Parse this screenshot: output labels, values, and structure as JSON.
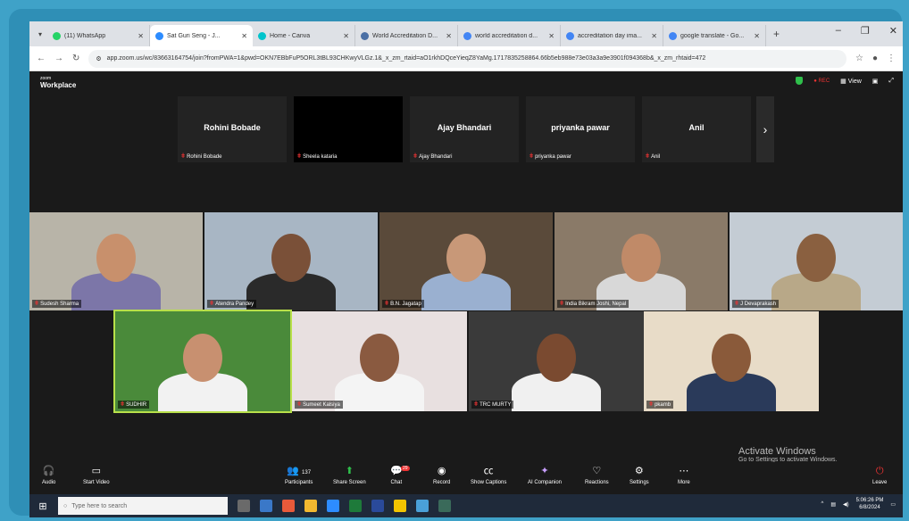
{
  "browser": {
    "tabs": [
      {
        "title": "(11) WhatsApp",
        "favicon_color": "#25d366",
        "active": false
      },
      {
        "title": "Sat Guri Seng - J...",
        "favicon_color": "#2d8cff",
        "active": true
      },
      {
        "title": "Home - Canva",
        "favicon_color": "#00c4cc",
        "active": false
      },
      {
        "title": "World Accreditation D...",
        "favicon_color": "#4a6fa5",
        "active": false
      },
      {
        "title": "world accreditation d...",
        "favicon_color": "#4285f4",
        "active": false
      },
      {
        "title": "accreditation day ima...",
        "favicon_color": "#4285f4",
        "active": false
      },
      {
        "title": "google translate - Go...",
        "favicon_color": "#4285f4",
        "active": false
      }
    ],
    "url": "app.zoom.us/wc/83663164754/join?fromPWA=1&pwd=OKN7EBbFuP5ORL3tBL93CHKwyVLGz.1&_x_zm_rtaid=aO1rkhDQceYieqZ8YaMg.1717835258864.66b5eb988e73e03a3a9e3901f094368b&_x_zm_rhtaid=472"
  },
  "zoom": {
    "logo_top": "zoom",
    "logo_bottom": "Workplace",
    "rec_label": "● REC",
    "view_label": "View"
  },
  "top_strip": [
    {
      "display": "Rohini Bobade",
      "label": "Rohini Bobade"
    },
    {
      "display": "",
      "label": "Sheela kataria"
    },
    {
      "display": "Ajay Bhandari",
      "label": "Ajay Bhandari"
    },
    {
      "display": "priyanka pawar",
      "label": "priyanka pawar"
    },
    {
      "display": "Anil",
      "label": "Anil"
    }
  ],
  "gallery": [
    {
      "label": "Sudesh Sharma",
      "bg": "#b8b4a8",
      "shirt": "#7c76a8",
      "skin": "#c8906c"
    },
    {
      "label": "Atendra Pandey",
      "bg": "#a8b6c4",
      "shirt": "#2a2a2a",
      "skin": "#7a5038"
    },
    {
      "label": "B.N. Jagatap",
      "bg": "#5a4a3a",
      "shirt": "#9ab0d0",
      "skin": "#c89878"
    },
    {
      "label": "India Bikram Joshi, Nepal",
      "bg": "#8a7a68",
      "shirt": "#d8d8d8",
      "skin": "#c08a68"
    },
    {
      "label": "J Devaprakash",
      "bg": "#c4ccd4",
      "shirt": "#b8a888",
      "skin": "#8a6040"
    },
    {
      "label": "SUDHIR",
      "bg": "#4a8a3a",
      "shirt": "#f2f2f2",
      "skin": "#c89070"
    },
    {
      "label": "Sumeet Kalsiya",
      "bg": "#e8e0e0",
      "shirt": "#f4f4f4",
      "skin": "#8a5a40"
    },
    {
      "label": "TRC MURTY",
      "bg": "#3a3a3a",
      "shirt": "#f0f0f0",
      "skin": "#7a4a30"
    },
    {
      "label": "pkamb",
      "bg": "#e8dcc8",
      "shirt": "#2a3a5a",
      "skin": "#8a5a3a"
    }
  ],
  "watermark": {
    "title": "Activate Windows",
    "subtitle": "Go to Settings to activate Windows."
  },
  "toolbar": {
    "audio": "Audio",
    "video": "Start Video",
    "participants": "Participants",
    "participants_count": "137",
    "share": "Share Screen",
    "chat": "Chat",
    "chat_badge": "29",
    "record": "Record",
    "captions": "Show Captions",
    "companion": "AI Companion",
    "reactions": "Reactions",
    "settings": "Settings",
    "more": "More",
    "leave": "Leave"
  },
  "taskbar": {
    "search_placeholder": "Type here to search",
    "time": "5:06:26 PM",
    "date": "6/8/2024"
  }
}
